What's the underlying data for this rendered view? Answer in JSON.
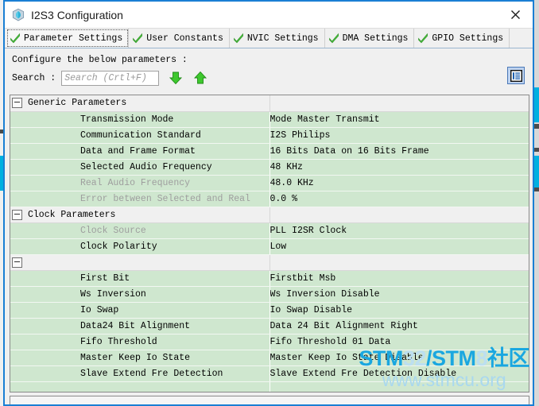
{
  "window": {
    "title": "I2S3 Configuration",
    "icon": "cube-icon",
    "close_label": "✕",
    "border_color": "#1a7fd4"
  },
  "tabs": [
    {
      "label": "Parameter Settings",
      "selected": true,
      "icon": "check-icon"
    },
    {
      "label": "User Constants",
      "selected": false,
      "icon": "check-icon"
    },
    {
      "label": "NVIC Settings",
      "selected": false,
      "icon": "check-icon"
    },
    {
      "label": "DMA Settings",
      "selected": false,
      "icon": "check-icon"
    },
    {
      "label": "GPIO Settings",
      "selected": false,
      "icon": "check-icon"
    }
  ],
  "instruction": "Configure the below parameters :",
  "search": {
    "label": "Search :",
    "value": "",
    "placeholder": "Search (Crtl+F)",
    "next_icon": "arrow-down-icon",
    "prev_icon": "arrow-up-icon"
  },
  "view_toggle": {
    "icon": "list-view-icon"
  },
  "table": {
    "groups": [
      {
        "label": "Generic Parameters",
        "rows": [
          {
            "name": "Transmission Mode",
            "value": "Mode Master Transmit",
            "dim": false
          },
          {
            "name": "Communication Standard",
            "value": "I2S Philips",
            "dim": false
          },
          {
            "name": "Data and Frame Format",
            "value": "16 Bits Data on 16 Bits Frame",
            "dim": false
          },
          {
            "name": "Selected Audio Frequency",
            "value": "48 KHz",
            "dim": false
          },
          {
            "name": "Real Audio Frequency",
            "value": "48.0 KHz",
            "dim": true
          },
          {
            "name": "Error between Selected and Real",
            "value": "0.0 %",
            "dim": true
          }
        ]
      },
      {
        "label": "Clock Parameters",
        "rows": [
          {
            "name": "Clock Source",
            "value": "PLL I2SR Clock",
            "dim": true
          },
          {
            "name": "Clock Polarity",
            "value": "Low",
            "dim": false
          }
        ]
      },
      {
        "label": "",
        "rows": [
          {
            "name": "First Bit",
            "value": "Firstbit Msb",
            "dim": false
          },
          {
            "name": "Ws Inversion",
            "value": "Ws Inversion Disable",
            "dim": false
          },
          {
            "name": "Io Swap",
            "value": "Io Swap Disable",
            "dim": false
          },
          {
            "name": "Data24 Bit Alignment",
            "value": "Data 24 Bit Alignment Right",
            "dim": false
          },
          {
            "name": "Fifo Threshold",
            "value": "Fifo Threshold 01 Data",
            "dim": false
          },
          {
            "name": "Master Keep Io State",
            "value": "Master Keep Io State Disable",
            "dim": false
          },
          {
            "name": "Slave Extend Fre Detection",
            "value": "Slave Extend Fre Detection Disable",
            "dim": false
          },
          {
            "name": "",
            "value": "",
            "dim": false
          }
        ]
      }
    ]
  },
  "watermark": {
    "line1_a": "STM",
    "line1_b": "32",
    "line1_c": "/STM",
    "line1_d": "8",
    "line1_e": "社区",
    "line2": "www.stmcu.org"
  }
}
